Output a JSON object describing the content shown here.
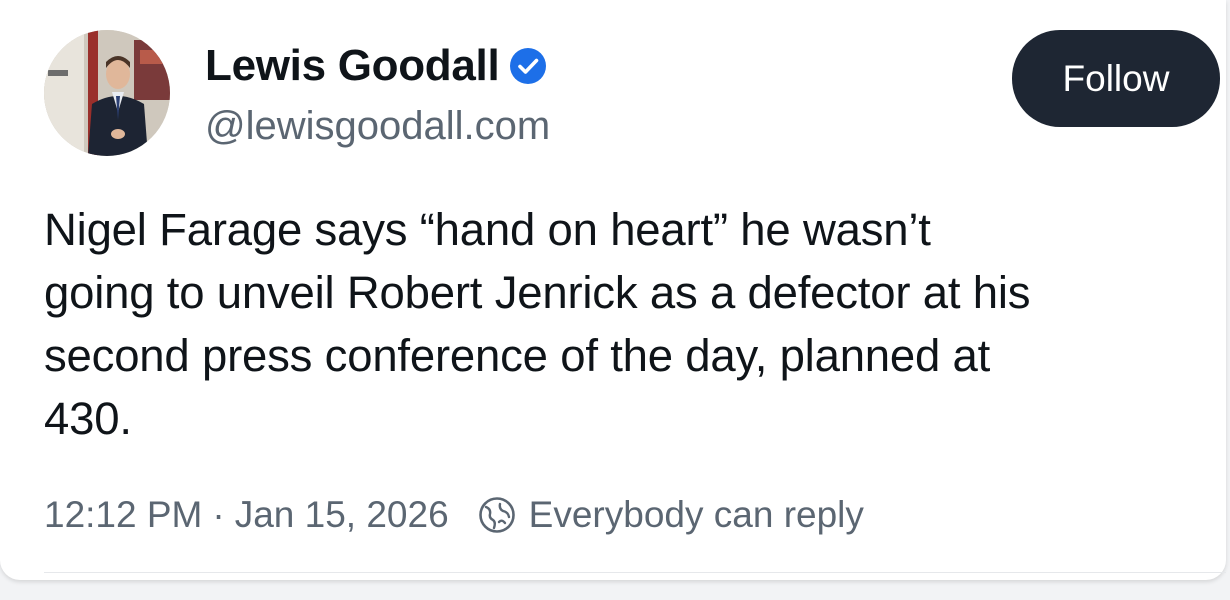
{
  "author": {
    "display_name": "Lewis Goodall",
    "handle": "@lewisgoodall.com",
    "verified": true
  },
  "actions": {
    "follow_label": "Follow"
  },
  "post": {
    "lines": [
      "Nigel Farage says “hand on heart” he wasn’t",
      "going to unveil Robert Jenrick as a defector at his",
      "second press conference of the day, planned at",
      "430."
    ]
  },
  "meta": {
    "time": "12:12 PM",
    "separator": "·",
    "date": "Jan 15, 2026",
    "reply_setting": "Everybody can reply"
  },
  "icons": {
    "verified": "verified-check-icon",
    "reply_setting": "globe-icon"
  },
  "colors": {
    "follow_button_bg": "#1e2633",
    "verified_badge": "#1d6fe8",
    "secondary_text": "#5b6672"
  }
}
